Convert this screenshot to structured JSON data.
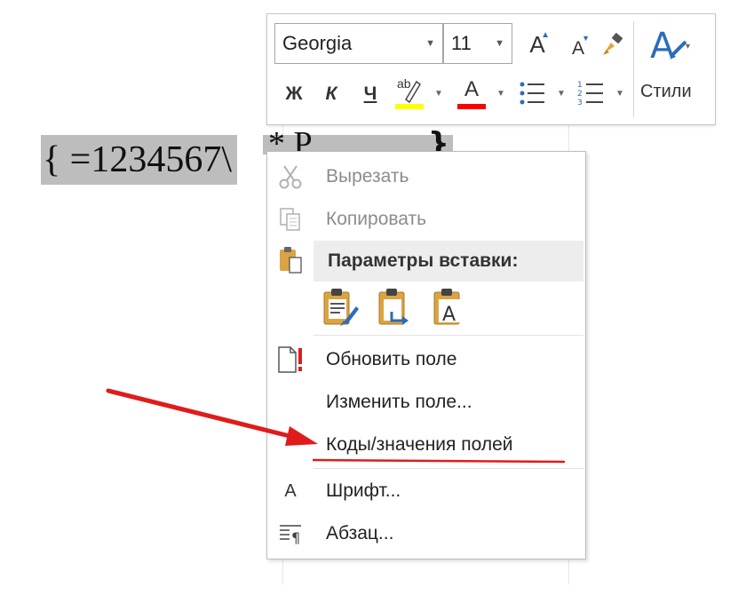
{
  "document": {
    "field_code_visible": "{ =1234567\\",
    "field_code_hidden": "* Р",
    "field_code_close": "}"
  },
  "mini_toolbar": {
    "font_name": "Georgia",
    "font_size": "11",
    "bold_label": "Ж",
    "italic_label": "К",
    "underline_label": "Ч",
    "highlight_icon": "ab",
    "font_color_label": "A",
    "grow_font_label": "A",
    "shrink_font_label": "A",
    "styles_label": "Стили",
    "icons": [
      "grow-font-icon",
      "shrink-font-icon",
      "format-painter-icon",
      "styles-icon",
      "highlight-icon",
      "font-color-icon",
      "bullets-icon",
      "numbering-icon"
    ],
    "colors": {
      "highlight": "#ffff00",
      "font_color": "#ff0000",
      "styles_accent": "#2b6cb8"
    }
  },
  "context_menu": {
    "cut": "Вырезать",
    "copy": "Копировать",
    "paste_header": "Параметры вставки:",
    "paste_options": [
      "paste-keep-formatting-icon",
      "paste-merge-formatting-icon",
      "paste-text-only-icon"
    ],
    "update_field": "Обновить поле",
    "edit_field": "Изменить поле...",
    "toggle_field_codes": "Коды/значения полей",
    "font": "Шрифт...",
    "paragraph": "Абзац...",
    "font_icon_label": "A"
  },
  "annotation": {
    "arrow_color": "#e01b1b"
  }
}
